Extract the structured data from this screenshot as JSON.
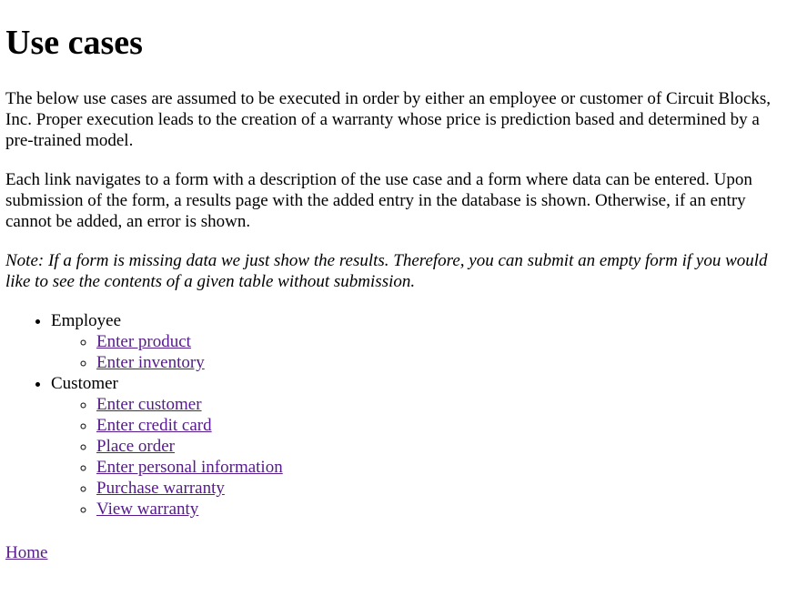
{
  "page": {
    "title": "Use cases",
    "intro": "The below use cases are assumed to be executed in order by either an employee or customer of Circuit Blocks, Inc. Proper execution leads to the creation of a warranty whose price is prediction based and determined by a pre-trained model.",
    "description": "Each link navigates to a form with a description of the use case and a form where data can be entered. Upon submission of the form, a results page with the added entry in the database is shown. Otherwise, if an entry cannot be added, an error is shown.",
    "note": "Note: If a form is missing data we just show the results. Therefore, you can submit an empty form if you would like to see the contents of a given table without submission."
  },
  "groups": [
    {
      "label": "Employee",
      "links": [
        "Enter product",
        "Enter inventory"
      ]
    },
    {
      "label": "Customer",
      "links": [
        "Enter customer",
        "Enter credit card",
        "Place order",
        "Enter personal information",
        "Purchase warranty",
        "View warranty"
      ]
    }
  ],
  "footer": {
    "home_label": "Home"
  },
  "colors": {
    "link_visited": "#551a8b",
    "text": "#000000",
    "background": "#ffffff"
  }
}
